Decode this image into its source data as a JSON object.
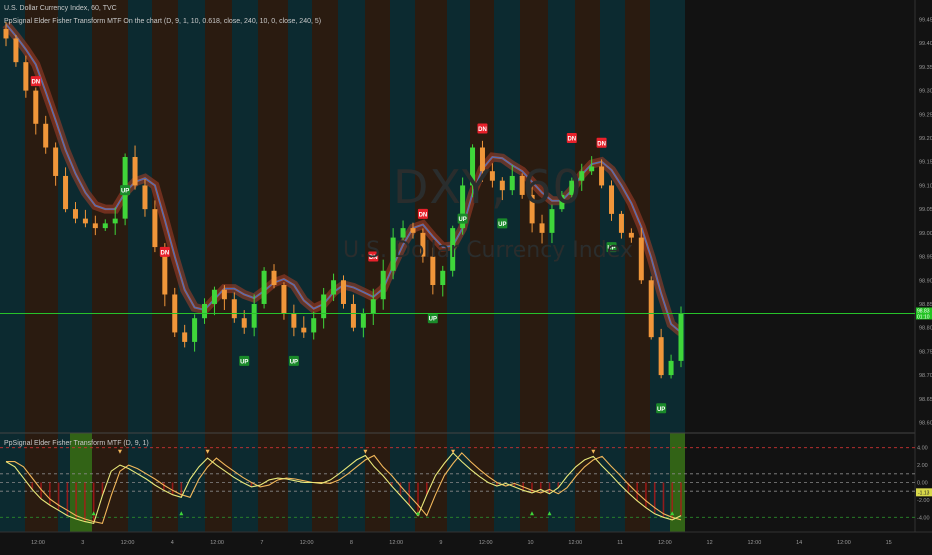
{
  "header": {
    "symbol_line": "U.S. Dollar Currency Index, 60, TVC",
    "indicator_line": "PpSignal Elder Fisher Transform MTF On the chart (D, 9, 1, 10, 0.618, close, 240, 10, 0, close, 240, 5)"
  },
  "watermark": {
    "ticker": "DXY, 60",
    "name": "U.S. Dollar Currency Index"
  },
  "price_axis": {
    "ticks": [
      "99.45",
      "99.40",
      "99.35",
      "99.30",
      "99.25",
      "99.20",
      "99.15",
      "99.10",
      "99.05",
      "99.00",
      "98.95",
      "98.90",
      "98.85",
      "98.80",
      "98.75",
      "98.70",
      "98.65",
      "98.60"
    ],
    "current_price": "98.83",
    "current_price_sub": "01:10"
  },
  "time_axis": {
    "labels": [
      "12:00",
      "3",
      "12:00",
      "4",
      "12:00",
      "7",
      "12:00",
      "8",
      "12:00",
      "9",
      "12:00",
      "10",
      "12:00",
      "11",
      "12:00",
      "12",
      "12:00",
      "14",
      "12:00",
      "15"
    ]
  },
  "osc": {
    "title": "PpSignal Elder Fisher Transform MTF (D, 9, 1)",
    "axis_ticks": [
      "4.00",
      "2.00",
      "0.00",
      "-2.00",
      "-4.00"
    ],
    "current_value": "-1.13"
  },
  "signals": [
    {
      "label": "DN",
      "type": "sell"
    },
    {
      "label": "DN",
      "type": "sell"
    },
    {
      "label": "UP",
      "type": "buy"
    },
    {
      "label": "UP",
      "type": "buy"
    },
    {
      "label": "DN",
      "type": "sell"
    },
    {
      "label": "UP",
      "type": "buy"
    },
    {
      "label": "UP",
      "type": "buy"
    },
    {
      "label": "UP",
      "type": "buy"
    },
    {
      "label": "DN",
      "type": "sell"
    },
    {
      "label": "UP",
      "type": "buy"
    },
    {
      "label": "DN",
      "type": "sell"
    },
    {
      "label": "UP",
      "type": "buy"
    },
    {
      "label": "DN",
      "type": "sell"
    },
    {
      "label": "UP",
      "type": "buy"
    },
    {
      "label": "DN",
      "type": "sell"
    }
  ],
  "colors": {
    "background": "#121212",
    "bull_zone": "#0c2a30",
    "bear_zone": "#2a1b10",
    "bull_candle": "#3fd63a",
    "bear_candle": "#f0963a",
    "band_outer": "#a8402a",
    "band_inner": "#3e6fc6",
    "price_line": "#27c22a",
    "fisher": "#e8e87a",
    "trigger": "#f2b75a",
    "hist_neg": "#b01818",
    "sell_tag": "#e8212b",
    "buy_tag": "#1a8a2a"
  },
  "chart_data": [
    {
      "type": "candlestick",
      "title": "U.S. Dollar Currency Index, 60, TVC",
      "ylim": [
        98.58,
        99.47
      ],
      "x_tick_labels": [
        "12:00",
        "3",
        "12:00",
        "4",
        "12:00",
        "7",
        "12:00",
        "8",
        "12:00",
        "9",
        "12:00",
        "10"
      ],
      "close_path_approx": [
        99.41,
        99.36,
        99.3,
        99.23,
        99.18,
        99.12,
        99.05,
        99.03,
        99.02,
        99.01,
        99.02,
        99.03,
        99.16,
        99.1,
        99.05,
        98.97,
        98.87,
        98.79,
        98.77,
        98.82,
        98.85,
        98.88,
        98.86,
        98.82,
        98.8,
        98.85,
        98.92,
        98.89,
        98.83,
        98.8,
        98.79,
        98.82,
        98.87,
        98.9,
        98.85,
        98.8,
        98.83,
        98.86,
        98.92,
        98.99,
        99.01,
        99.0,
        98.95,
        98.89,
        98.92,
        99.01,
        99.1,
        99.18,
        99.13,
        99.11,
        99.09,
        99.12,
        99.08,
        99.02,
        99.0,
        99.05,
        99.08,
        99.11,
        99.13,
        99.14,
        99.1,
        99.04,
        99.0,
        98.99,
        98.9,
        98.78,
        98.7,
        98.73,
        98.83
      ],
      "last_price": 98.83
    },
    {
      "type": "line",
      "title": "PpSignal Elder Fisher Transform MTF (D, 9, 1)",
      "ylim": [
        -5.0,
        5.0
      ],
      "reference_levels": [
        4.0,
        1.0,
        0.0,
        -1.0,
        -4.0
      ],
      "series": [
        {
          "values": [
            2.4,
            1.8,
            0.5,
            -0.8,
            -1.9,
            -2.6,
            -3.2,
            -3.8,
            -4.2,
            -4.5,
            -4.7,
            -1.5,
            1.3,
            2.0,
            1.6,
            1.0,
            0.4,
            -0.3,
            -0.9,
            -1.4,
            -1.7,
            0.4,
            1.8,
            2.8,
            2.0,
            1.3,
            0.6,
            0.0,
            -0.5,
            -0.3,
            0.3,
            0.5,
            0.4,
            0.2,
            0.0,
            0.0,
            -0.1,
            0.3,
            1.0,
            1.8,
            2.6,
            3.1,
            1.8,
            0.8,
            -0.4,
            -1.5,
            -2.6,
            -3.8,
            -1.4,
            0.8,
            2.2,
            3.4,
            2.4,
            1.5,
            0.7,
            0.0,
            -0.4,
            -0.1,
            -0.5,
            -0.9,
            -1.2,
            -0.8,
            -1.3,
            -0.6,
            0.7,
            1.8,
            2.6,
            3.0,
            1.9,
            0.9,
            -0.2,
            -1.2,
            -2.1,
            -2.9,
            -3.6,
            -4.0,
            -4.3,
            -3.8
          ]
        }
      ]
    }
  ]
}
